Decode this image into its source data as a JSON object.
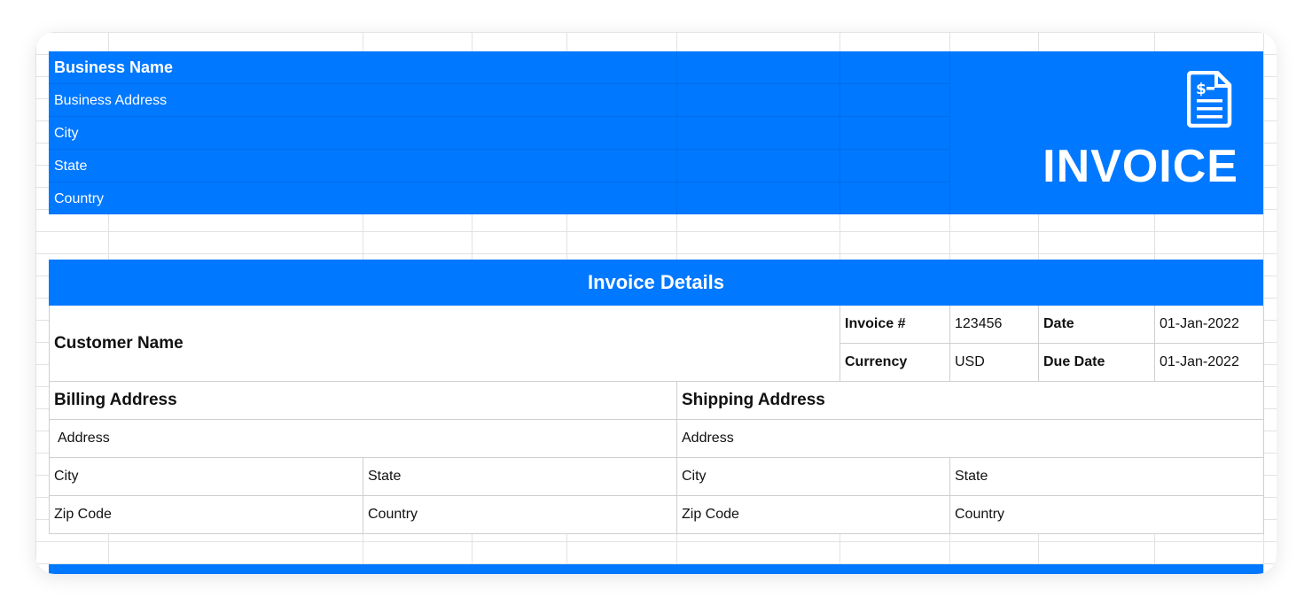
{
  "header": {
    "business_name": "Business Name",
    "business_address": "Business Address",
    "city": "City",
    "state": "State",
    "country": "Country",
    "title": "INVOICE",
    "icon": "invoice-document-dollar-icon"
  },
  "details": {
    "band_title": "Invoice Details",
    "customer_name": "Customer Name",
    "invoice_no_label": "Invoice #",
    "invoice_no_value": "123456",
    "date_label": "Date",
    "date_value": "01-Jan-2022",
    "currency_label": "Currency",
    "currency_value": "USD",
    "due_date_label": "Due Date",
    "due_date_value": "01-Jan-2022"
  },
  "billing": {
    "title": "Billing Address",
    "address": "Address",
    "city": "City",
    "state": "State",
    "zip": "Zip Code",
    "country": "Country"
  },
  "shipping": {
    "title": "Shipping Address",
    "address": "Address",
    "city": "City",
    "state": "State",
    "zip": "Zip Code",
    "country": "Country"
  },
  "colors": {
    "accent": "#0078ff",
    "grid": "#e2e2e2",
    "border": "#cfcfcf"
  }
}
